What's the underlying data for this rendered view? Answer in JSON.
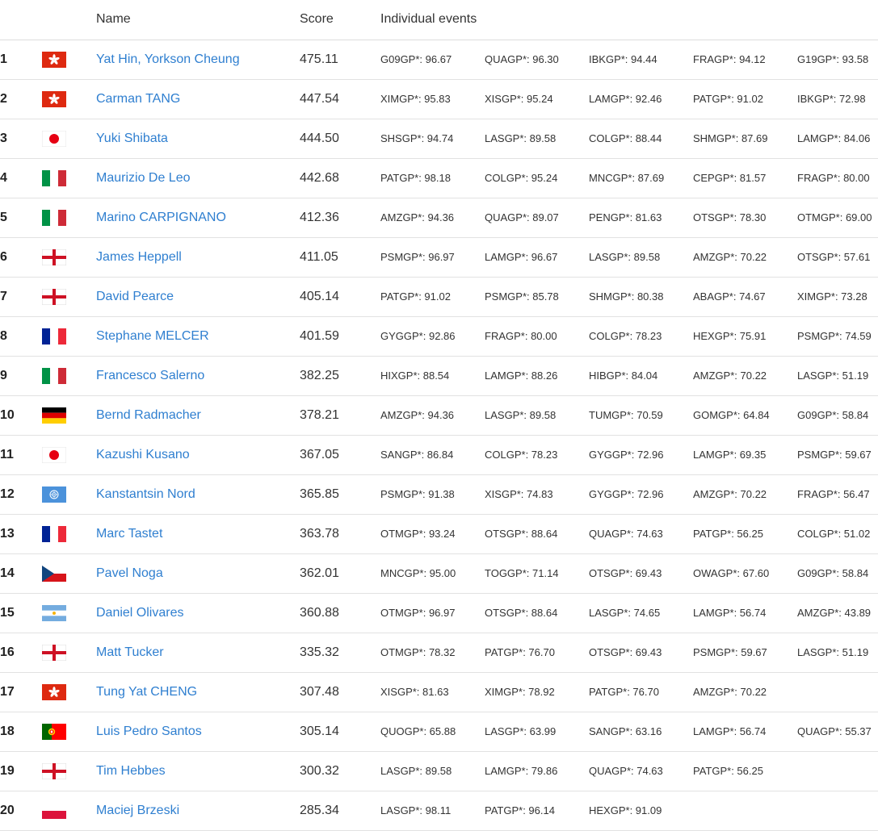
{
  "table": {
    "headers": {
      "rank": "",
      "flag": "",
      "name": "Name",
      "score": "Score",
      "events": "Individual events"
    },
    "rows": [
      {
        "rank": "1",
        "flag": "hong-kong-flag",
        "name": "Yat Hin, Yorkson Cheung",
        "score": "475.11",
        "events": [
          "G09GP*: 96.67",
          "QUAGP*: 96.30",
          "IBKGP*: 94.44",
          "FRAGP*: 94.12",
          "G19GP*: 93.58"
        ]
      },
      {
        "rank": "2",
        "flag": "hong-kong-flag",
        "name": "Carman TANG",
        "score": "447.54",
        "events": [
          "XIMGP*: 95.83",
          "XISGP*: 95.24",
          "LAMGP*: 92.46",
          "PATGP*: 91.02",
          "IBKGP*: 72.98"
        ]
      },
      {
        "rank": "3",
        "flag": "japan-flag",
        "name": "Yuki Shibata",
        "score": "444.50",
        "events": [
          "SHSGP*: 94.74",
          "LASGP*: 89.58",
          "COLGP*: 88.44",
          "SHMGP*: 87.69",
          "LAMGP*: 84.06"
        ]
      },
      {
        "rank": "4",
        "flag": "italy-flag",
        "name": "Maurizio De Leo",
        "score": "442.68",
        "events": [
          "PATGP*: 98.18",
          "COLGP*: 95.24",
          "MNCGP*: 87.69",
          "CEPGP*: 81.57",
          "FRAGP*: 80.00"
        ]
      },
      {
        "rank": "5",
        "flag": "italy-flag",
        "name": "Marino CARPIGNANO",
        "score": "412.36",
        "events": [
          "AMZGP*: 94.36",
          "QUAGP*: 89.07",
          "PENGP*: 81.63",
          "OTSGP*: 78.30",
          "OTMGP*: 69.00"
        ]
      },
      {
        "rank": "6",
        "flag": "england-flag",
        "name": "James Heppell",
        "score": "411.05",
        "events": [
          "PSMGP*: 96.97",
          "LAMGP*: 96.67",
          "LASGP*: 89.58",
          "AMZGP*: 70.22",
          "OTSGP*: 57.61"
        ]
      },
      {
        "rank": "7",
        "flag": "england-flag",
        "name": "David Pearce",
        "score": "405.14",
        "events": [
          "PATGP*: 91.02",
          "PSMGP*: 85.78",
          "SHMGP*: 80.38",
          "ABAGP*: 74.67",
          "XIMGP*: 73.28"
        ]
      },
      {
        "rank": "8",
        "flag": "france-flag",
        "name": "Stephane MELCER",
        "score": "401.59",
        "events": [
          "GYGGP*: 92.86",
          "FRAGP*: 80.00",
          "COLGP*: 78.23",
          "HEXGP*: 75.91",
          "PSMGP*: 74.59"
        ]
      },
      {
        "rank": "9",
        "flag": "italy-flag",
        "name": "Francesco Salerno",
        "score": "382.25",
        "events": [
          "HIXGP*: 88.54",
          "LAMGP*: 88.26",
          "HIBGP*: 84.04",
          "AMZGP*: 70.22",
          "LASGP*: 51.19"
        ]
      },
      {
        "rank": "10",
        "flag": "germany-flag",
        "name": "Bernd Radmacher",
        "score": "378.21",
        "events": [
          "AMZGP*: 94.36",
          "LASGP*: 89.58",
          "TUMGP*: 70.59",
          "GOMGP*: 64.84",
          "G09GP*: 58.84"
        ]
      },
      {
        "rank": "11",
        "flag": "japan-flag",
        "name": "Kazushi Kusano",
        "score": "367.05",
        "events": [
          "SANGP*: 86.84",
          "COLGP*: 78.23",
          "GYGGP*: 72.96",
          "LAMGP*: 69.35",
          "PSMGP*: 59.67"
        ]
      },
      {
        "rank": "12",
        "flag": "united-nations-flag",
        "name": "Kanstantsin Nord",
        "score": "365.85",
        "events": [
          "PSMGP*: 91.38",
          "XISGP*: 74.83",
          "GYGGP*: 72.96",
          "AMZGP*: 70.22",
          "FRAGP*: 56.47"
        ]
      },
      {
        "rank": "13",
        "flag": "france-flag",
        "name": "Marc Tastet",
        "score": "363.78",
        "events": [
          "OTMGP*: 93.24",
          "OTSGP*: 88.64",
          "QUAGP*: 74.63",
          "PATGP*: 56.25",
          "COLGP*: 51.02"
        ]
      },
      {
        "rank": "14",
        "flag": "czechia-flag",
        "name": "Pavel Noga",
        "score": "362.01",
        "events": [
          "MNCGP*: 95.00",
          "TOGGP*: 71.14",
          "OTSGP*: 69.43",
          "OWAGP*: 67.60",
          "G09GP*: 58.84"
        ]
      },
      {
        "rank": "15",
        "flag": "argentina-flag",
        "name": "Daniel Olivares",
        "score": "360.88",
        "events": [
          "OTMGP*: 96.97",
          "OTSGP*: 88.64",
          "LASGP*: 74.65",
          "LAMGP*: 56.74",
          "AMZGP*: 43.89"
        ]
      },
      {
        "rank": "16",
        "flag": "england-flag",
        "name": "Matt Tucker",
        "score": "335.32",
        "events": [
          "OTMGP*: 78.32",
          "PATGP*: 76.70",
          "OTSGP*: 69.43",
          "PSMGP*: 59.67",
          "LASGP*: 51.19"
        ]
      },
      {
        "rank": "17",
        "flag": "hong-kong-flag",
        "name": "Tung Yat CHENG",
        "score": "307.48",
        "events": [
          "XISGP*: 81.63",
          "XIMGP*: 78.92",
          "PATGP*: 76.70",
          "AMZGP*: 70.22",
          ""
        ]
      },
      {
        "rank": "18",
        "flag": "portugal-flag",
        "name": "Luis Pedro Santos",
        "score": "305.14",
        "events": [
          "QUOGP*: 65.88",
          "LASGP*: 63.99",
          "SANGP*: 63.16",
          "LAMGP*: 56.74",
          "QUAGP*: 55.37"
        ]
      },
      {
        "rank": "19",
        "flag": "england-flag",
        "name": "Tim Hebbes",
        "score": "300.32",
        "events": [
          "LASGP*: 89.58",
          "LAMGP*: 79.86",
          "QUAGP*: 74.63",
          "PATGP*: 56.25",
          ""
        ]
      },
      {
        "rank": "20",
        "flag": "poland-flag",
        "name": "Maciej Brzeski",
        "score": "285.34",
        "events": [
          "LASGP*: 98.11",
          "PATGP*: 96.14",
          "HEXGP*: 91.09",
          "",
          ""
        ]
      }
    ]
  },
  "colors": {
    "link": "#2f7fd0",
    "border": "#e2e2e2",
    "text": "#333333"
  }
}
